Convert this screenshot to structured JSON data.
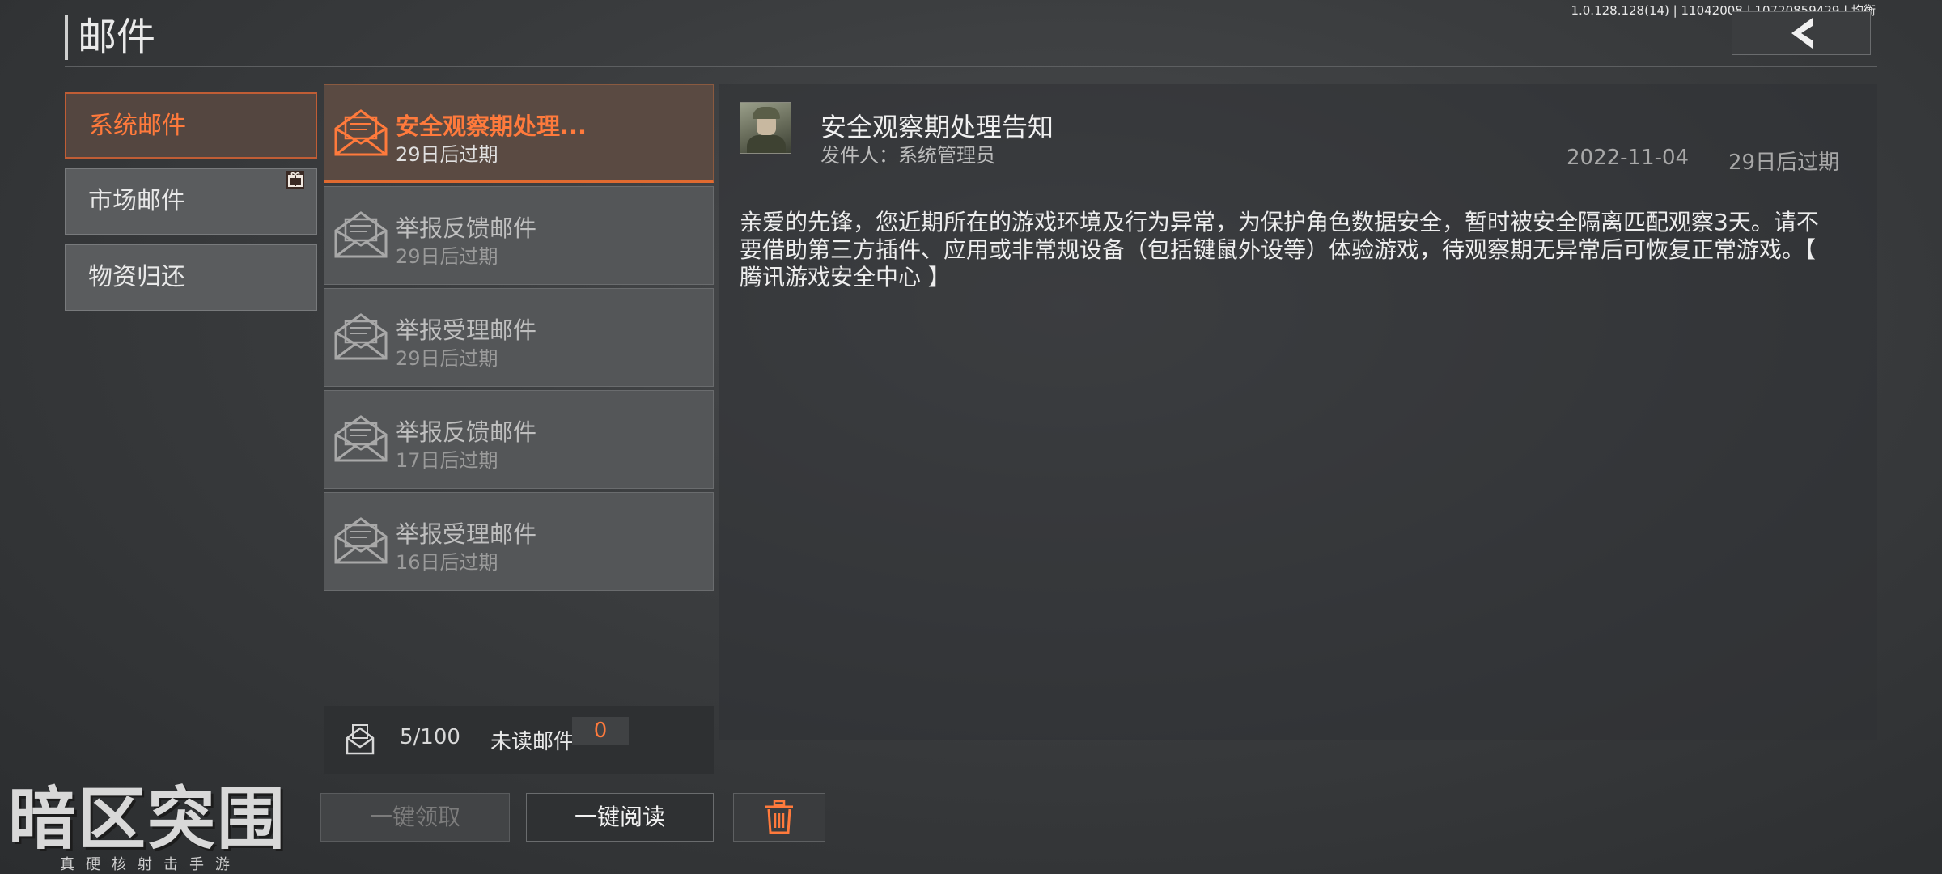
{
  "build_info": "1.0.128.128(14) | 11042008 | 10720859429 | 均衡",
  "page_title": "邮件",
  "categories": [
    {
      "label": "系统邮件",
      "active": true
    },
    {
      "label": "市场邮件",
      "active": false,
      "badge": "gift-icon"
    },
    {
      "label": "物资归还",
      "active": false
    }
  ],
  "mails": [
    {
      "subject": "安全观察期处理...",
      "expire": "29日后过期",
      "active": true
    },
    {
      "subject": "举报反馈邮件",
      "expire": "29日后过期",
      "active": false
    },
    {
      "subject": "举报受理邮件",
      "expire": "29日后过期",
      "active": false
    },
    {
      "subject": "举报反馈邮件",
      "expire": "17日后过期",
      "active": false
    },
    {
      "subject": "举报受理邮件",
      "expire": "16日后过期",
      "active": false
    }
  ],
  "list_footer": {
    "count": "5/100",
    "unread_label": "未读邮件",
    "unread_count": "0"
  },
  "detail": {
    "subject": "安全观察期处理告知",
    "sender": "发件人：系统管理员",
    "date": "2022-11-04",
    "expire": "29日后过期",
    "body": "亲爱的先锋，您近期所在的游戏环境及行为异常，为保护角色数据安全，暂时被安全隔离匹配观察3天。请不要借助第三方插件、应用或非常规设备（包括键鼠外设等）体验游戏，待观察期无异常后可恢复正常游戏。【 腾讯游戏安全中心 】"
  },
  "buttons": {
    "claim_all": "一键领取",
    "read_all": "一键阅读",
    "delete_icon": "trash-icon"
  },
  "logo": {
    "mark": "暗区突围",
    "tagline": "真硬核射击手游"
  },
  "colors": {
    "accent": "#ff7a3c",
    "active_border": "#e06a30"
  }
}
